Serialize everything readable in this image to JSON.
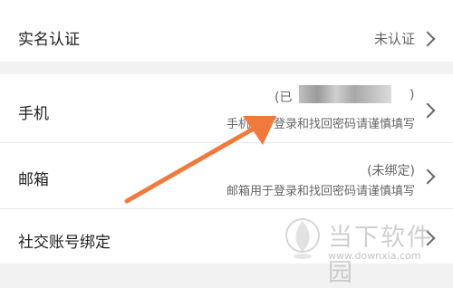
{
  "settings": {
    "real_name": {
      "label": "实名认证",
      "value": "未认证"
    },
    "phone": {
      "label": "手机",
      "status_prefix": "(已",
      "status_suffix": ")",
      "hint": "手机用于登录和找回密码请谨慎填写"
    },
    "email": {
      "label": "邮箱",
      "status": "(未绑定)",
      "hint": "邮箱用于登录和找回密码请谨慎填写"
    },
    "social": {
      "label": "社交账号绑定"
    }
  },
  "watermark": {
    "brand": "当下软件园",
    "url": "www.downxia.com"
  },
  "colors": {
    "arrow": "#f07a3c",
    "background": "#f2f2f2",
    "row": "#ffffff"
  }
}
